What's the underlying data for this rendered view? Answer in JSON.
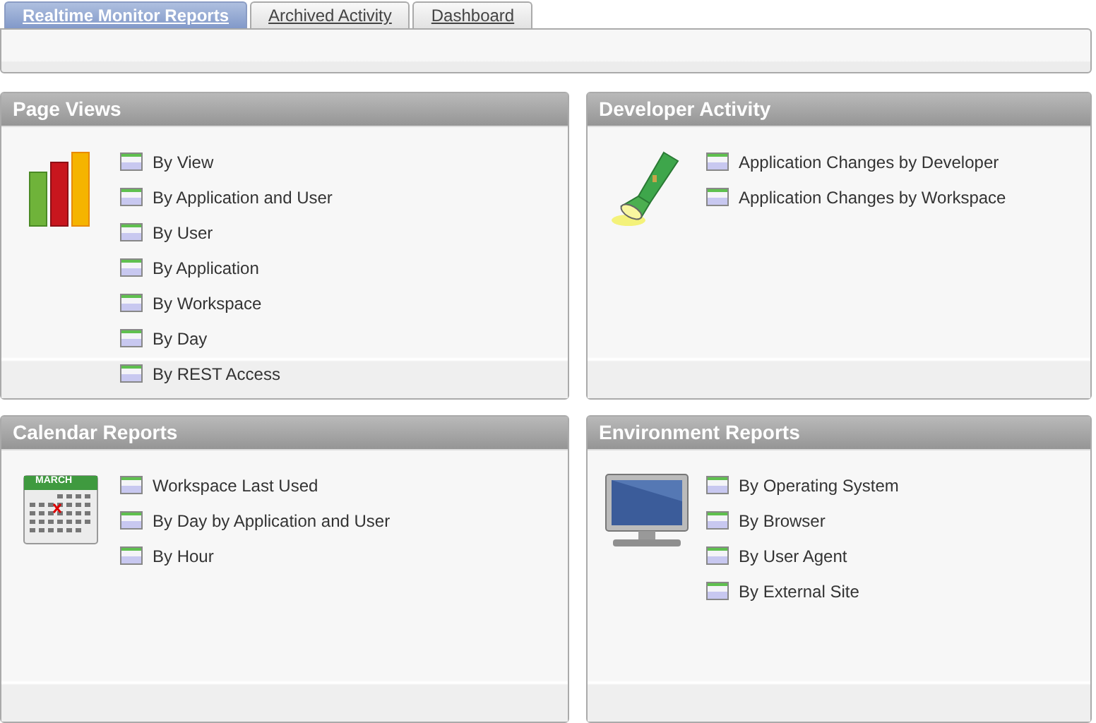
{
  "tabs": [
    {
      "label": "Realtime Monitor Reports",
      "selected": true
    },
    {
      "label": "Archived Activity",
      "selected": false
    },
    {
      "label": "Dashboard",
      "selected": false
    }
  ],
  "regions": [
    {
      "title": "Page Views",
      "kind": "bars",
      "links": [
        "By View",
        "By Application and User",
        "By User",
        "By Application",
        "By Workspace",
        "By Day",
        "By REST Access"
      ]
    },
    {
      "title": "Developer Activity",
      "kind": "flashlight",
      "links": [
        "Application Changes by Developer",
        "Application Changes by Workspace"
      ]
    },
    {
      "title": "Calendar Reports",
      "kind": "calendar",
      "month": "MARCH",
      "links": [
        "Workspace Last Used",
        "By Day by Application and User",
        "By Hour"
      ]
    },
    {
      "title": "Environment Reports",
      "kind": "monitor",
      "links": [
        "By Operating System",
        "By Browser",
        "By User Agent",
        "By External Site"
      ]
    }
  ]
}
